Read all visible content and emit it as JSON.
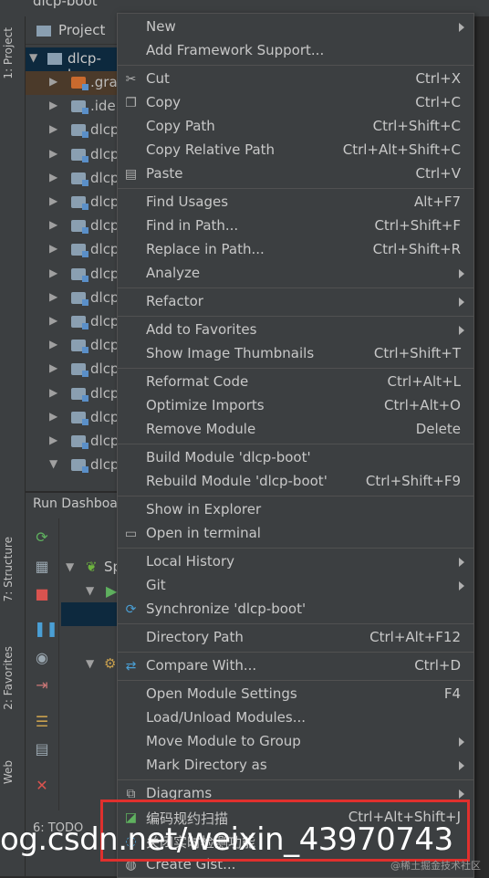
{
  "app": {
    "title": "dlcp-boot"
  },
  "side_tabs": {
    "project": "1: Project",
    "structure": "7: Structure",
    "favorites": "2: Favorites",
    "web": "Web"
  },
  "project_panel": {
    "title": "Project",
    "root": "dlcp-bo",
    "rows": [
      ".gra",
      ".ide",
      "dlcp",
      "dlcp",
      "dlcp",
      "dlcp",
      "dlcp",
      "dlcp",
      "dlcp",
      "dlcp",
      "dlcp",
      "dlcp",
      "dlcp",
      "dlcp",
      "dlcp",
      "dlcp",
      "dlcp"
    ]
  },
  "run_panel": {
    "title": "Run Dashboa",
    "item": "Sp"
  },
  "bottom_tabs": {
    "todo": "6: TODO"
  },
  "context_menu": {
    "items": [
      {
        "label": "New",
        "shortcut": "",
        "submenu": true,
        "icon": ""
      },
      {
        "label": "Add Framework Support...",
        "shortcut": "",
        "submenu": false,
        "icon": ""
      },
      {
        "sep": true
      },
      {
        "label": "Cut",
        "shortcut": "Ctrl+X",
        "submenu": false,
        "icon": "scissors-icon"
      },
      {
        "label": "Copy",
        "shortcut": "Ctrl+C",
        "submenu": false,
        "icon": "copy-icon"
      },
      {
        "label": "Copy Path",
        "shortcut": "Ctrl+Shift+C",
        "submenu": false,
        "icon": ""
      },
      {
        "label": "Copy Relative Path",
        "shortcut": "Ctrl+Alt+Shift+C",
        "submenu": false,
        "icon": ""
      },
      {
        "label": "Paste",
        "shortcut": "Ctrl+V",
        "submenu": false,
        "icon": "paste-icon"
      },
      {
        "sep": true
      },
      {
        "label": "Find Usages",
        "shortcut": "Alt+F7",
        "submenu": false,
        "icon": ""
      },
      {
        "label": "Find in Path...",
        "shortcut": "Ctrl+Shift+F",
        "submenu": false,
        "icon": ""
      },
      {
        "label": "Replace in Path...",
        "shortcut": "Ctrl+Shift+R",
        "submenu": false,
        "icon": ""
      },
      {
        "label": "Analyze",
        "shortcut": "",
        "submenu": true,
        "icon": ""
      },
      {
        "sep": true
      },
      {
        "label": "Refactor",
        "shortcut": "",
        "submenu": true,
        "icon": ""
      },
      {
        "sep": true
      },
      {
        "label": "Add to Favorites",
        "shortcut": "",
        "submenu": true,
        "icon": ""
      },
      {
        "label": "Show Image Thumbnails",
        "shortcut": "Ctrl+Shift+T",
        "submenu": false,
        "icon": ""
      },
      {
        "sep": true
      },
      {
        "label": "Reformat Code",
        "shortcut": "Ctrl+Alt+L",
        "submenu": false,
        "icon": ""
      },
      {
        "label": "Optimize Imports",
        "shortcut": "Ctrl+Alt+O",
        "submenu": false,
        "icon": ""
      },
      {
        "label": "Remove Module",
        "shortcut": "Delete",
        "submenu": false,
        "icon": ""
      },
      {
        "sep": true
      },
      {
        "label": "Build Module 'dlcp-boot'",
        "shortcut": "",
        "submenu": false,
        "icon": ""
      },
      {
        "label": "Rebuild Module 'dlcp-boot'",
        "shortcut": "Ctrl+Shift+F9",
        "submenu": false,
        "icon": ""
      },
      {
        "sep": true
      },
      {
        "label": "Show in Explorer",
        "shortcut": "",
        "submenu": false,
        "icon": ""
      },
      {
        "label": "Open in terminal",
        "shortcut": "",
        "submenu": false,
        "icon": "terminal-icon"
      },
      {
        "sep": true
      },
      {
        "label": "Local History",
        "shortcut": "",
        "submenu": true,
        "icon": ""
      },
      {
        "label": "Git",
        "shortcut": "",
        "submenu": true,
        "icon": ""
      },
      {
        "label": "Synchronize 'dlcp-boot'",
        "shortcut": "",
        "submenu": false,
        "icon": "sync-icon"
      },
      {
        "sep": true
      },
      {
        "label": "Directory Path",
        "shortcut": "Ctrl+Alt+F12",
        "submenu": false,
        "icon": ""
      },
      {
        "sep": true
      },
      {
        "label": "Compare With...",
        "shortcut": "Ctrl+D",
        "submenu": false,
        "icon": "compare-icon"
      },
      {
        "sep": true
      },
      {
        "label": "Open Module Settings",
        "shortcut": "F4",
        "submenu": false,
        "icon": ""
      },
      {
        "label": "Load/Unload Modules...",
        "shortcut": "",
        "submenu": false,
        "icon": ""
      },
      {
        "label": "Move Module to Group",
        "shortcut": "",
        "submenu": true,
        "icon": ""
      },
      {
        "label": "Mark Directory as",
        "shortcut": "",
        "submenu": true,
        "icon": ""
      },
      {
        "sep": true
      },
      {
        "label": "Diagrams",
        "shortcut": "",
        "submenu": true,
        "icon": "diagram-icon"
      },
      {
        "label": "编码规约扫描",
        "shortcut": "Ctrl+Alt+Shift+J",
        "submenu": false,
        "icon": "scan-icon"
      },
      {
        "label": "关闭实时检测功能",
        "shortcut": "",
        "submenu": false,
        "icon": "realtime-icon"
      },
      {
        "label": "Create Gist...",
        "shortcut": "",
        "submenu": false,
        "icon": "github-icon"
      }
    ]
  },
  "watermark": {
    "text": "og.csdn.net/weixin_43970743",
    "corner": "@稀土掘金技术社区"
  },
  "colors": {
    "highlight": "#e0302d",
    "selection": "#0d293e",
    "menu_bg": "#3c3f41"
  }
}
